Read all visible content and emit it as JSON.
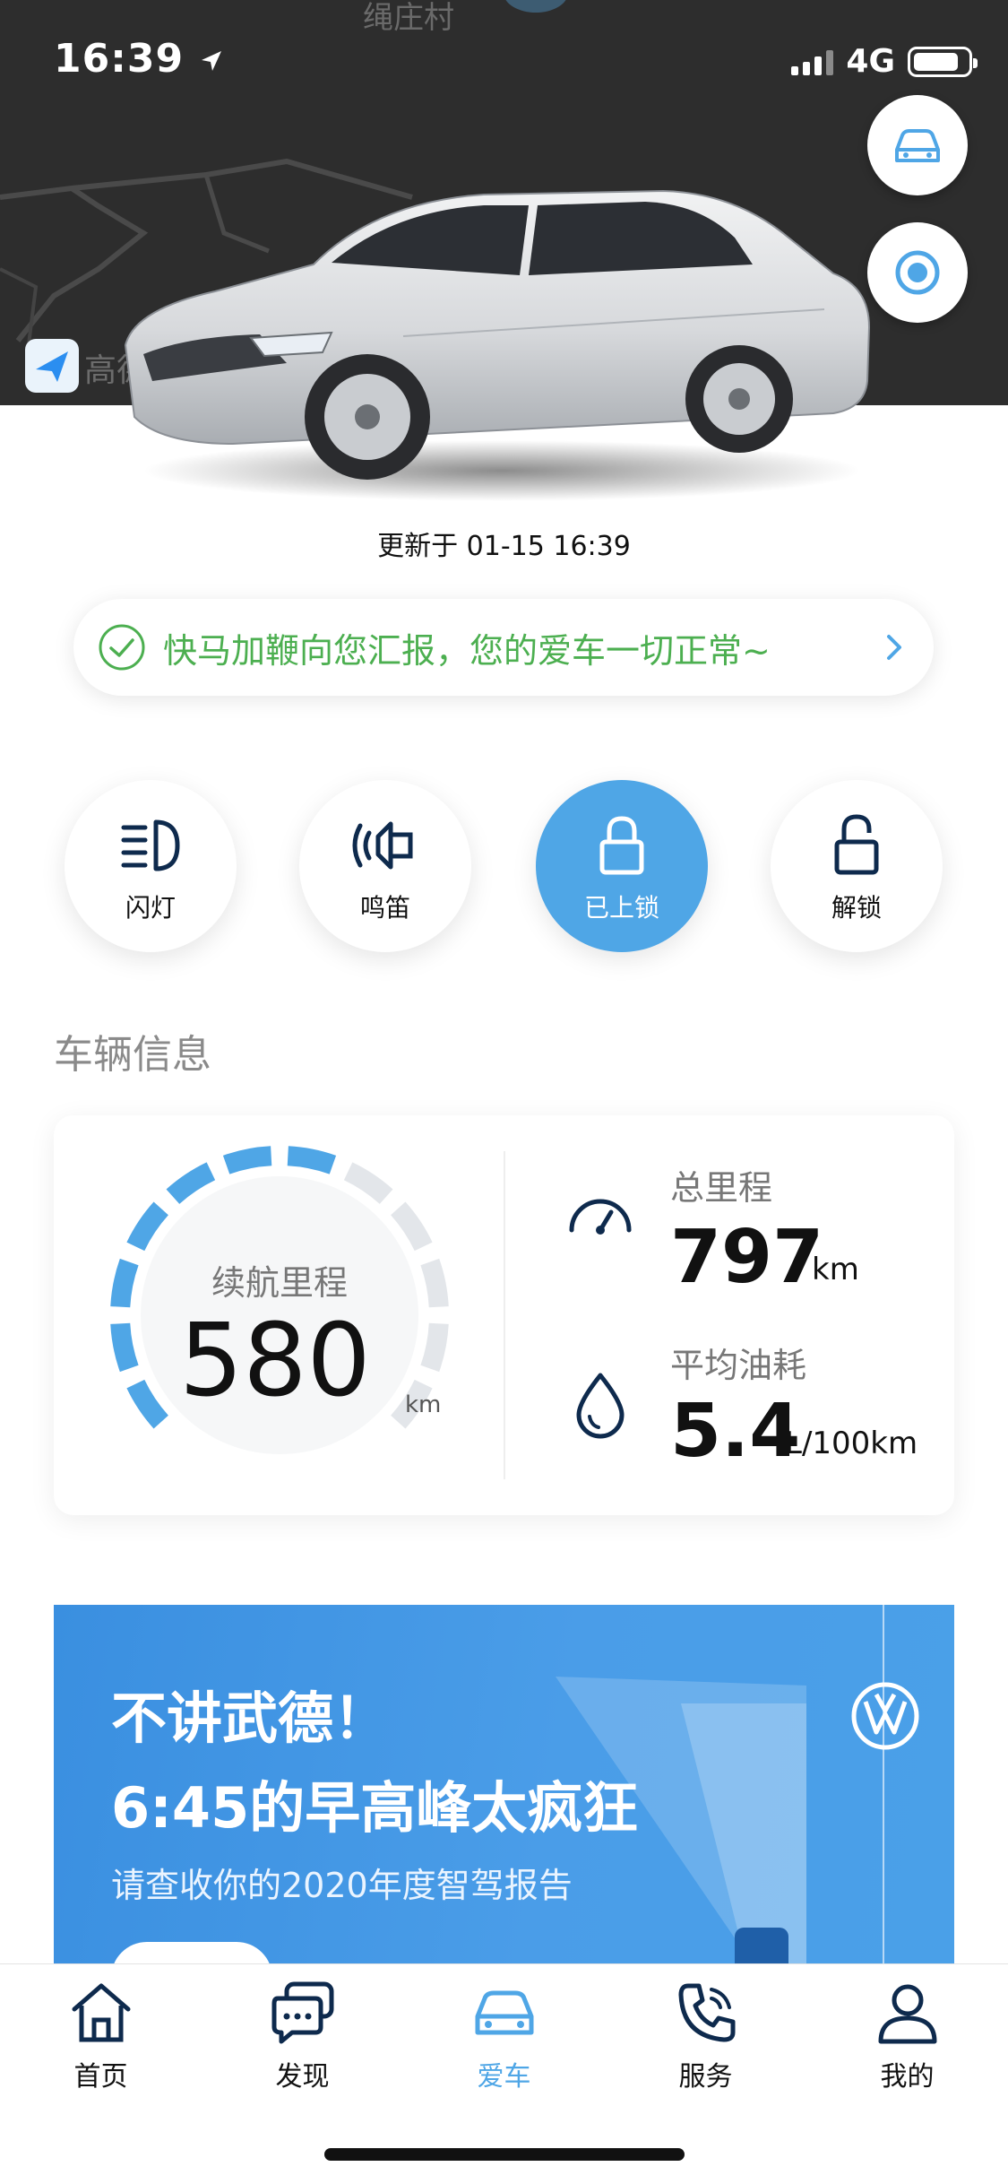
{
  "status_bar": {
    "time": "16:39",
    "network": "4G",
    "battery_fraction": 0.85
  },
  "map": {
    "place_label": "绳庄村",
    "amap_label": "高德"
  },
  "updated": {
    "text": "更新于 01-15 16:39"
  },
  "notice": {
    "text": "快马加鞭向您汇报，您的爱车一切正常~"
  },
  "actions": [
    {
      "label": "闪灯",
      "icon": "headlight-flash-icon",
      "active": false
    },
    {
      "label": "鸣笛",
      "icon": "horn-icon",
      "active": false
    },
    {
      "label": "已上锁",
      "icon": "lock-closed-icon",
      "active": true
    },
    {
      "label": "解锁",
      "icon": "lock-open-icon",
      "active": false
    }
  ],
  "vehicle_info": {
    "section_title": "车辆信息",
    "range": {
      "label": "续航里程",
      "value": "580",
      "unit": "km",
      "fill_fraction": 0.62
    },
    "odometer": {
      "label": "总里程",
      "value": "797",
      "unit": "km",
      "icon": "speedometer-icon"
    },
    "fuel": {
      "label": "平均油耗",
      "value": "5.4",
      "unit": "L/100km",
      "icon": "fuel-drop-icon"
    }
  },
  "banner": {
    "line1": "不讲武德！",
    "line2": "6:45的早高峰太疯狂",
    "line3": "请查收你的2020年度智驾报告",
    "logo": "vw-logo"
  },
  "tabs": [
    {
      "label": "首页",
      "icon": "home-icon",
      "active": false
    },
    {
      "label": "发现",
      "icon": "chat-bubbles-icon",
      "active": false
    },
    {
      "label": "爱车",
      "icon": "car-icon",
      "active": true
    },
    {
      "label": "服务",
      "icon": "phone-icon",
      "active": false
    },
    {
      "label": "我的",
      "icon": "user-icon",
      "active": false
    }
  ],
  "colors": {
    "accent": "#4fa6e6",
    "ok_green": "#4caf50",
    "map_bg": "#2d2d2d",
    "icon_navy": "#0e2a4d",
    "gauge_inactive": "#e3e6ea"
  }
}
